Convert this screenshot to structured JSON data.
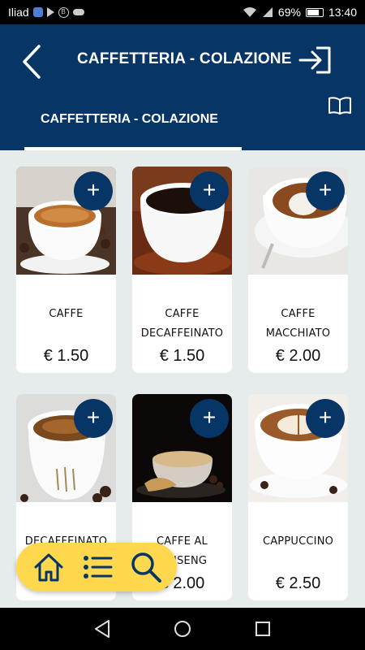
{
  "status_bar": {
    "carrier": "Iliad",
    "battery_percent": "69%",
    "time": "13:40"
  },
  "header": {
    "title": "CAFFETTERIA - COLAZIONE",
    "active_tab": "CAFFETTERIA - COLAZIONE",
    "color": "#073565"
  },
  "products": [
    {
      "name_line1": "CAFFE",
      "name_line2": "",
      "price": "€ 1.50"
    },
    {
      "name_line1": "CAFFE",
      "name_line2": "DECAFFEINATO",
      "price": "€ 1.50"
    },
    {
      "name_line1": "CAFFE",
      "name_line2": "MACCHIATO",
      "price": "€ 2.00"
    },
    {
      "name_line1": "DECAFFEINATO",
      "name_line2": "",
      "price": ""
    },
    {
      "name_line1": "CAFFE AL",
      "name_line2": "GINSENG",
      "price": "€ 2.00"
    },
    {
      "name_line1": "CAPPUCCINO",
      "name_line2": "",
      "price": "€ 2.50"
    }
  ],
  "add_button_label": "+",
  "toolbar": {
    "color": "#ffd84d",
    "icons": [
      "home-icon",
      "list-icon",
      "search-icon"
    ]
  },
  "nav": {
    "icons": [
      "back-triangle-icon",
      "home-circle-icon",
      "recents-square-icon"
    ]
  }
}
